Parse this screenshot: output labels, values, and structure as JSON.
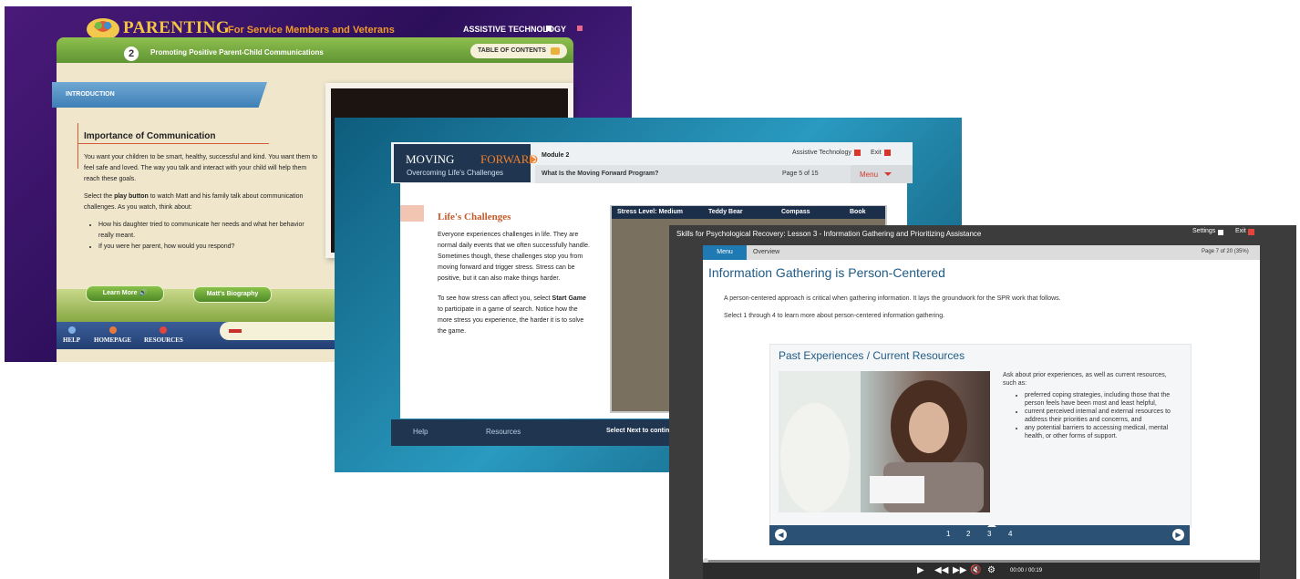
{
  "parenting": {
    "title_main": "PARENTING",
    "title_sub": "For Service Members and Veterans",
    "assistive_label": "ASSISTIVE TECHNOLOGY",
    "lesson_number": "2",
    "lesson_title": "Promoting Positive Parent-Child Communications",
    "toc_label": "TABLE OF CONTENTS",
    "section_label": "INTRODUCTION",
    "heading": "Importance of Communication",
    "para1": "You want your children to be smart, healthy, successful and kind. You want them to feel safe and loved. The way you talk and interact with your child will help them reach these goals.",
    "para2_pre": "Select the ",
    "para2_bold": "play button",
    "para2_post": " to watch Matt and his family talk about communication challenges. As you watch, think about:",
    "bullets": [
      "How his daughter tried to communicate her needs and what her behavior really meant.",
      "If you were her parent, how would you respond?"
    ],
    "learn_more": "Learn More",
    "bio_button": "Matt's Biography",
    "nav": [
      "HELP",
      "HOMEPAGE",
      "RESOURCES"
    ]
  },
  "moving_forward": {
    "brand_a": "MOVING",
    "brand_b": "FORWARD",
    "brand_sub": "Overcoming Life's Challenges",
    "module": "Module 2",
    "assistive_label": "Assistive Technology",
    "exit_label": "Exit",
    "question": "What Is the Moving Forward Program?",
    "page": "Page 5 of 15",
    "menu": "Menu",
    "heading": "Life's Challenges",
    "para1": "Everyone experiences challenges in life. They are normal daily events that we often successfully handle. Sometimes though, these challenges stop you from moving forward and trigger stress. Stress can be positive, but it can also make things harder.",
    "para2_pre": "To see how stress can affect you, select ",
    "para2_bold": "Start Game",
    "para2_post": " to participate in a game of search. Notice how the more stress you experience, the harder it is to solve the game.",
    "stress_level": "Stress Level: Medium",
    "game_items": [
      "Teddy Bear",
      "Compass",
      "Book"
    ],
    "footer_help": "Help",
    "footer_resources": "Resources",
    "footer_next": "Select Next to continue"
  },
  "spr": {
    "window_title": "Skills for Psychological Recovery: Lesson 3 - Information Gathering and Prioritizing Assistance",
    "settings": "Settings",
    "exit": "Exit",
    "menu_tab": "Menu",
    "overview_tab": "Overview",
    "page_info": "Page 7 of 20 (35%)",
    "heading": "Information Gathering is Person-Centered",
    "para1": "A person-centered approach is critical when gathering information. It lays the groundwork for the SPR work that follows.",
    "para2": "Select 1 through 4 to learn more about person-centered information gathering.",
    "card_title": "Past Experiences / Current Resources",
    "card_intro": "Ask about prior experiences, as well as current resources, such as:",
    "card_bullets": [
      "preferred coping strategies, including those that the person feels have been most and least helpful,",
      "current perceived internal and external resources to address their priorities and concerns, and",
      "any potential barriers to accessing medical, mental health, or other forms of support."
    ],
    "pages": [
      "1",
      "2",
      "3",
      "4"
    ],
    "time": "00:00 / 00:19"
  }
}
